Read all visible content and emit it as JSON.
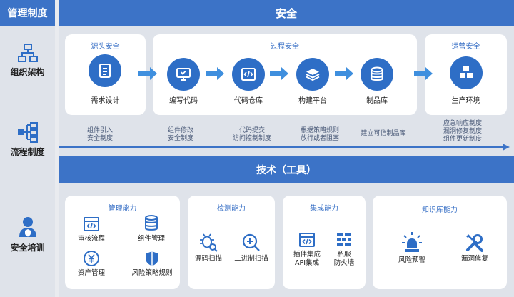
{
  "header": {
    "left_title": "管理制度",
    "main_title": "安全"
  },
  "left_column": {
    "org": {
      "label": "组织架构",
      "icon": "org-chart-icon"
    },
    "process": {
      "label": "流程制度",
      "icon": "process-tree-icon"
    },
    "training": {
      "label": "安全培训",
      "icon": "person-shield-icon"
    }
  },
  "pipeline": {
    "source": {
      "title": "源头安全",
      "step": "需求设计"
    },
    "process": {
      "title": "过程安全",
      "steps": [
        "编写代码",
        "代码仓库",
        "构建平台",
        "制品库"
      ]
    },
    "ops": {
      "title": "运营安全",
      "step": "生产环境"
    }
  },
  "process_labels": [
    [
      "组件引入",
      "安全制度"
    ],
    [
      "组件修改",
      "安全制度"
    ],
    [
      "代码提交",
      "访问控制制度"
    ],
    [
      "根据策略规则",
      "放行或者阻塞"
    ],
    [
      "建立可信制品库"
    ],
    [
      "应急响应制度",
      "漏洞修复制度",
      "组件更新制度"
    ]
  ],
  "tech_bar": {
    "title": "技术（工具）"
  },
  "capabilities": {
    "management": {
      "title": "管理能力",
      "items": [
        "审核流程",
        "组件管理",
        "资产管理",
        "风险策略规则"
      ]
    },
    "detection": {
      "title": "检测能力",
      "items": [
        "源码扫描",
        "二进制扫描"
      ]
    },
    "integration": {
      "title": "集成能力",
      "items": [
        [
          "插件集成",
          "API集成"
        ],
        [
          "私服",
          "防火墙"
        ]
      ]
    },
    "knowledge": {
      "title": "知识库能力",
      "items": [
        "风险预警",
        "漏洞修复"
      ]
    }
  },
  "colors": {
    "accent": "#3c73c7",
    "icon_blue": "#2e6ec6",
    "background": "#dfe3ea"
  }
}
